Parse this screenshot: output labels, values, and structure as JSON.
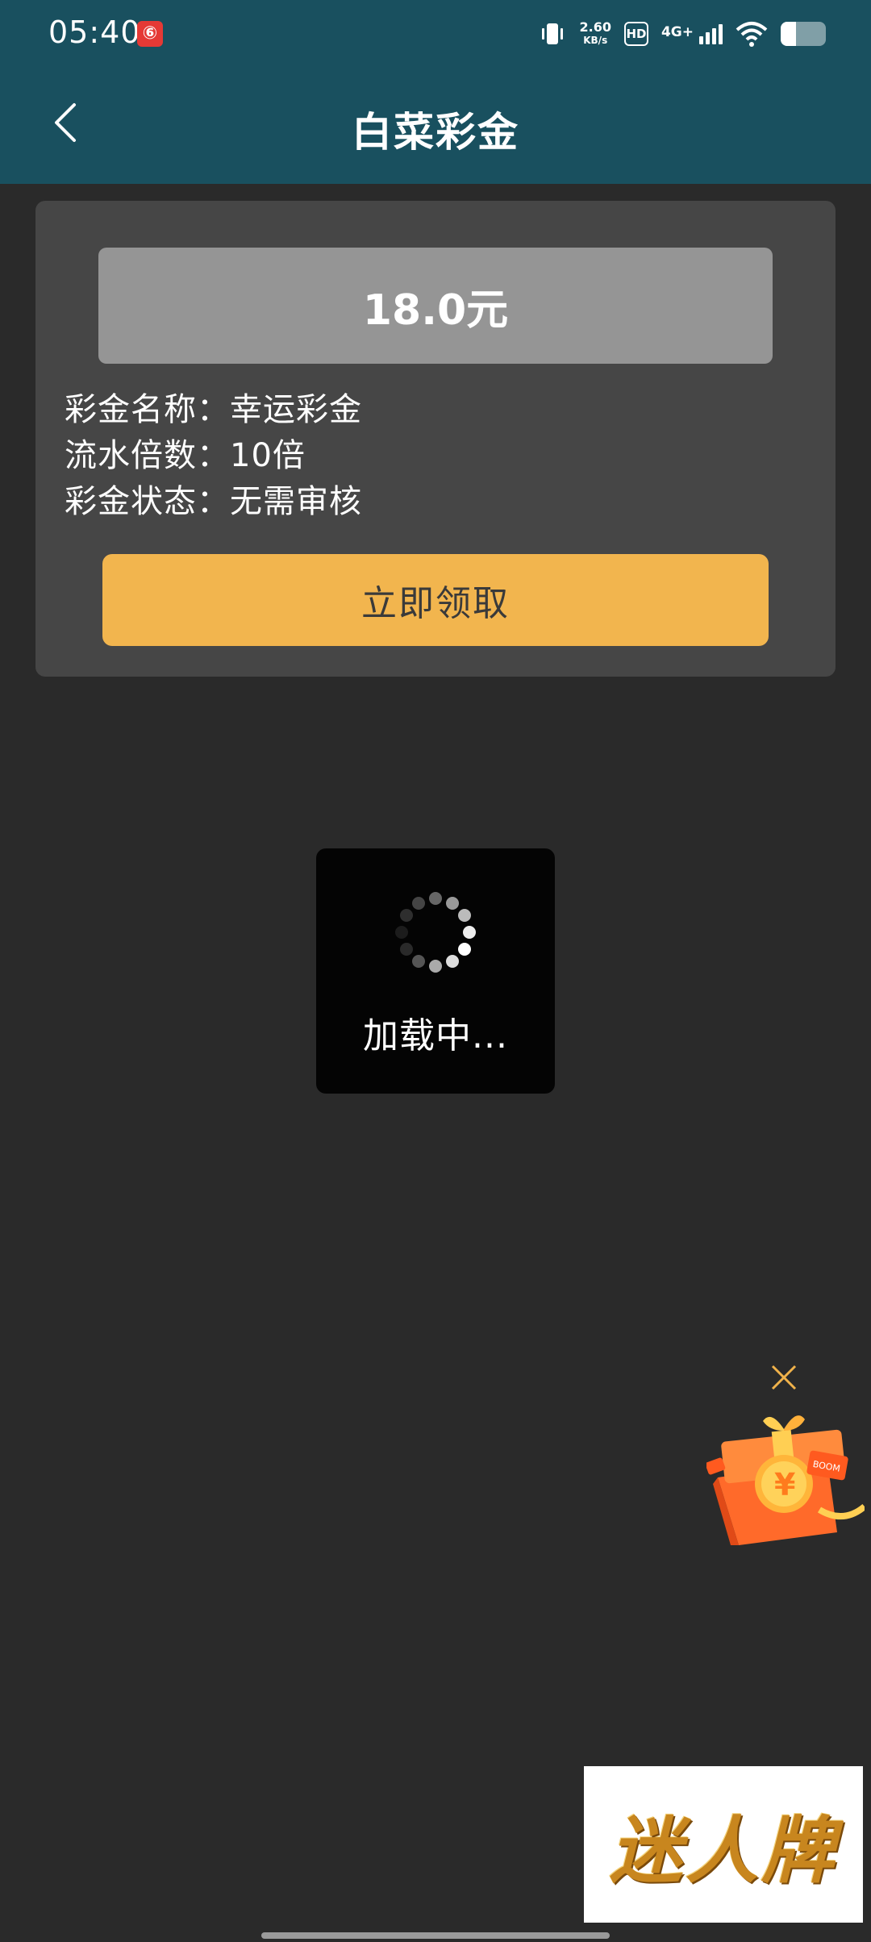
{
  "status_bar": {
    "time": "05:40",
    "netease_glyph": "⑥",
    "net_speed_value": "2.60",
    "net_speed_unit": "KB/s",
    "hd_label": "HD",
    "network_type": "4G+",
    "battery_level": 0.34
  },
  "header": {
    "title": "白菜彩金",
    "back_icon": "chevron-left-icon"
  },
  "card": {
    "amount": "18.0元",
    "rows": [
      {
        "label": "彩金名称：",
        "value": "幸运彩金"
      },
      {
        "label": "流水倍数：",
        "value": "10倍"
      },
      {
        "label": "彩金状态：",
        "value": "无需审核"
      }
    ],
    "claim_button": "立即领取"
  },
  "loading": {
    "text": "加载中..."
  },
  "gift": {
    "close_icon": "close-icon",
    "currency_symbol": "¥",
    "tag_text": "BOOM"
  },
  "brand": {
    "text": "迷人牌"
  },
  "colors": {
    "header_bg": "#19505f",
    "page_bg": "#2a2a2a",
    "card_bg": "#464646",
    "amount_bg": "#959595",
    "button_bg": "#f2b54e",
    "loading_bg": "#040404"
  }
}
